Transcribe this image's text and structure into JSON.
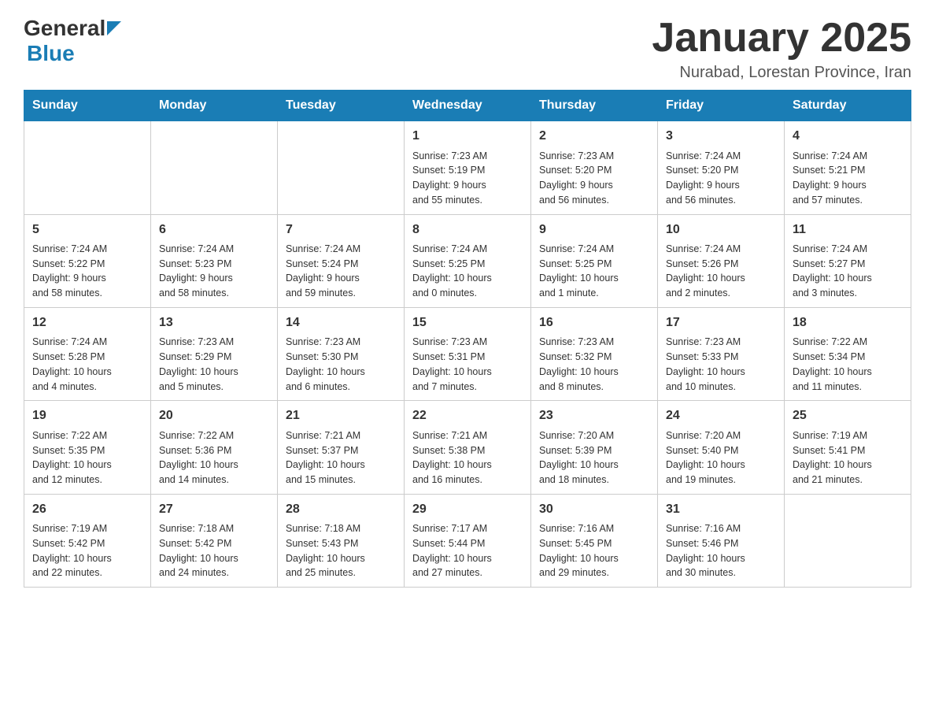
{
  "header": {
    "logo_general": "General",
    "logo_blue": "Blue",
    "month_title": "January 2025",
    "location": "Nurabad, Lorestan Province, Iran"
  },
  "days_of_week": [
    "Sunday",
    "Monday",
    "Tuesday",
    "Wednesday",
    "Thursday",
    "Friday",
    "Saturday"
  ],
  "weeks": [
    [
      {
        "day": "",
        "info": ""
      },
      {
        "day": "",
        "info": ""
      },
      {
        "day": "",
        "info": ""
      },
      {
        "day": "1",
        "info": "Sunrise: 7:23 AM\nSunset: 5:19 PM\nDaylight: 9 hours\nand 55 minutes."
      },
      {
        "day": "2",
        "info": "Sunrise: 7:23 AM\nSunset: 5:20 PM\nDaylight: 9 hours\nand 56 minutes."
      },
      {
        "day": "3",
        "info": "Sunrise: 7:24 AM\nSunset: 5:20 PM\nDaylight: 9 hours\nand 56 minutes."
      },
      {
        "day": "4",
        "info": "Sunrise: 7:24 AM\nSunset: 5:21 PM\nDaylight: 9 hours\nand 57 minutes."
      }
    ],
    [
      {
        "day": "5",
        "info": "Sunrise: 7:24 AM\nSunset: 5:22 PM\nDaylight: 9 hours\nand 58 minutes."
      },
      {
        "day": "6",
        "info": "Sunrise: 7:24 AM\nSunset: 5:23 PM\nDaylight: 9 hours\nand 58 minutes."
      },
      {
        "day": "7",
        "info": "Sunrise: 7:24 AM\nSunset: 5:24 PM\nDaylight: 9 hours\nand 59 minutes."
      },
      {
        "day": "8",
        "info": "Sunrise: 7:24 AM\nSunset: 5:25 PM\nDaylight: 10 hours\nand 0 minutes."
      },
      {
        "day": "9",
        "info": "Sunrise: 7:24 AM\nSunset: 5:25 PM\nDaylight: 10 hours\nand 1 minute."
      },
      {
        "day": "10",
        "info": "Sunrise: 7:24 AM\nSunset: 5:26 PM\nDaylight: 10 hours\nand 2 minutes."
      },
      {
        "day": "11",
        "info": "Sunrise: 7:24 AM\nSunset: 5:27 PM\nDaylight: 10 hours\nand 3 minutes."
      }
    ],
    [
      {
        "day": "12",
        "info": "Sunrise: 7:24 AM\nSunset: 5:28 PM\nDaylight: 10 hours\nand 4 minutes."
      },
      {
        "day": "13",
        "info": "Sunrise: 7:23 AM\nSunset: 5:29 PM\nDaylight: 10 hours\nand 5 minutes."
      },
      {
        "day": "14",
        "info": "Sunrise: 7:23 AM\nSunset: 5:30 PM\nDaylight: 10 hours\nand 6 minutes."
      },
      {
        "day": "15",
        "info": "Sunrise: 7:23 AM\nSunset: 5:31 PM\nDaylight: 10 hours\nand 7 minutes."
      },
      {
        "day": "16",
        "info": "Sunrise: 7:23 AM\nSunset: 5:32 PM\nDaylight: 10 hours\nand 8 minutes."
      },
      {
        "day": "17",
        "info": "Sunrise: 7:23 AM\nSunset: 5:33 PM\nDaylight: 10 hours\nand 10 minutes."
      },
      {
        "day": "18",
        "info": "Sunrise: 7:22 AM\nSunset: 5:34 PM\nDaylight: 10 hours\nand 11 minutes."
      }
    ],
    [
      {
        "day": "19",
        "info": "Sunrise: 7:22 AM\nSunset: 5:35 PM\nDaylight: 10 hours\nand 12 minutes."
      },
      {
        "day": "20",
        "info": "Sunrise: 7:22 AM\nSunset: 5:36 PM\nDaylight: 10 hours\nand 14 minutes."
      },
      {
        "day": "21",
        "info": "Sunrise: 7:21 AM\nSunset: 5:37 PM\nDaylight: 10 hours\nand 15 minutes."
      },
      {
        "day": "22",
        "info": "Sunrise: 7:21 AM\nSunset: 5:38 PM\nDaylight: 10 hours\nand 16 minutes."
      },
      {
        "day": "23",
        "info": "Sunrise: 7:20 AM\nSunset: 5:39 PM\nDaylight: 10 hours\nand 18 minutes."
      },
      {
        "day": "24",
        "info": "Sunrise: 7:20 AM\nSunset: 5:40 PM\nDaylight: 10 hours\nand 19 minutes."
      },
      {
        "day": "25",
        "info": "Sunrise: 7:19 AM\nSunset: 5:41 PM\nDaylight: 10 hours\nand 21 minutes."
      }
    ],
    [
      {
        "day": "26",
        "info": "Sunrise: 7:19 AM\nSunset: 5:42 PM\nDaylight: 10 hours\nand 22 minutes."
      },
      {
        "day": "27",
        "info": "Sunrise: 7:18 AM\nSunset: 5:42 PM\nDaylight: 10 hours\nand 24 minutes."
      },
      {
        "day": "28",
        "info": "Sunrise: 7:18 AM\nSunset: 5:43 PM\nDaylight: 10 hours\nand 25 minutes."
      },
      {
        "day": "29",
        "info": "Sunrise: 7:17 AM\nSunset: 5:44 PM\nDaylight: 10 hours\nand 27 minutes."
      },
      {
        "day": "30",
        "info": "Sunrise: 7:16 AM\nSunset: 5:45 PM\nDaylight: 10 hours\nand 29 minutes."
      },
      {
        "day": "31",
        "info": "Sunrise: 7:16 AM\nSunset: 5:46 PM\nDaylight: 10 hours\nand 30 minutes."
      },
      {
        "day": "",
        "info": ""
      }
    ]
  ]
}
